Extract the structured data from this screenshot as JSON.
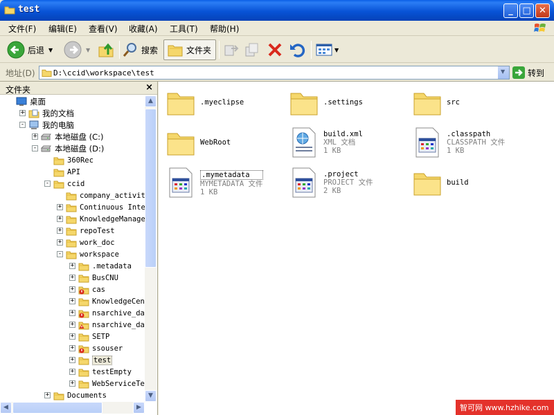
{
  "window": {
    "title": "test",
    "minimize": "_",
    "maximize": "□",
    "close": "✕"
  },
  "menu": [
    "文件(F)",
    "编辑(E)",
    "查看(V)",
    "收藏(A)",
    "工具(T)",
    "帮助(H)"
  ],
  "toolbar": {
    "back": "后退",
    "search": "搜索",
    "folders": "文件夹"
  },
  "address": {
    "label": "地址(D)",
    "value": "D:\\ccid\\workspace\\test",
    "go": "转到"
  },
  "folder_pane": {
    "title": "文件夹",
    "close": "×",
    "tree": [
      {
        "label": "桌面",
        "icon": "desktop-icon",
        "depth": 0,
        "exp": ""
      },
      {
        "label": "我的文档",
        "icon": "my-documents-icon",
        "depth": 1,
        "exp": "+"
      },
      {
        "label": "我的电脑",
        "icon": "my-computer-icon",
        "depth": 1,
        "exp": "-"
      },
      {
        "label": "本地磁盘 (C:)",
        "icon": "drive-icon",
        "depth": 2,
        "exp": "+"
      },
      {
        "label": "本地磁盘 (D:)",
        "icon": "drive-icon",
        "depth": 2,
        "exp": "-"
      },
      {
        "label": "360Rec",
        "icon": "folder-icon",
        "depth": 3,
        "exp": ""
      },
      {
        "label": "API",
        "icon": "folder-icon",
        "depth": 3,
        "exp": ""
      },
      {
        "label": "ccid",
        "icon": "folder-icon",
        "depth": 3,
        "exp": "-"
      },
      {
        "label": "company_activities",
        "icon": "folder-icon",
        "depth": 4,
        "exp": ""
      },
      {
        "label": "Continuous Integration",
        "icon": "folder-icon",
        "depth": 4,
        "exp": "+"
      },
      {
        "label": "KnowledgeManageSystem",
        "icon": "folder-icon",
        "depth": 4,
        "exp": "+"
      },
      {
        "label": "repoTest",
        "icon": "folder-icon",
        "depth": 4,
        "exp": "+"
      },
      {
        "label": "work_doc",
        "icon": "folder-icon",
        "depth": 4,
        "exp": "+"
      },
      {
        "label": "workspace",
        "icon": "folder-icon",
        "depth": 4,
        "exp": "-"
      },
      {
        "label": ".metadata",
        "icon": "folder-icon",
        "depth": 5,
        "exp": "+"
      },
      {
        "label": "BusCNU",
        "icon": "folder-icon",
        "depth": 5,
        "exp": "+"
      },
      {
        "label": "cas",
        "icon": "svn-conflict-folder-icon",
        "depth": 5,
        "exp": "+"
      },
      {
        "label": "KnowledgeCenter",
        "icon": "folder-icon",
        "depth": 5,
        "exp": "+"
      },
      {
        "label": "nsarchive_data",
        "icon": "svn-conflict-folder-icon",
        "depth": 5,
        "exp": "+"
      },
      {
        "label": "nsarchive_data",
        "icon": "svn-modified-folder-icon",
        "depth": 5,
        "exp": "+"
      },
      {
        "label": "SETP",
        "icon": "folder-icon",
        "depth": 5,
        "exp": "+"
      },
      {
        "label": "ssouser",
        "icon": "svn-conflict-folder-icon",
        "depth": 5,
        "exp": "+"
      },
      {
        "label": "test",
        "icon": "folder-icon",
        "depth": 5,
        "exp": "+",
        "selected": true
      },
      {
        "label": "testEmpty",
        "icon": "folder-icon",
        "depth": 5,
        "exp": "+"
      },
      {
        "label": "WebServiceTest",
        "icon": "folder-icon",
        "depth": 5,
        "exp": "+"
      },
      {
        "label": "Documents",
        "icon": "folder-icon",
        "depth": 3,
        "exp": "+"
      }
    ]
  },
  "files": [
    {
      "name": ".myeclipse",
      "type": "",
      "size": "",
      "icon": "folder-icon"
    },
    {
      "name": ".settings",
      "type": "",
      "size": "",
      "icon": "folder-icon"
    },
    {
      "name": "src",
      "type": "",
      "size": "",
      "icon": "folder-icon"
    },
    {
      "name": "WebRoot",
      "type": "",
      "size": "",
      "icon": "folder-icon"
    },
    {
      "name": "build.xml",
      "type": "XML 文档",
      "size": "1 KB",
      "icon": "xml-document-icon"
    },
    {
      "name": ".classpath",
      "type": "CLASSPATH 文件",
      "size": "1 KB",
      "icon": "generic-file-icon"
    },
    {
      "name": ".mymetadata",
      "type": "MYMETADATA 文件",
      "size": "1 KB",
      "icon": "generic-file-icon",
      "focused": true
    },
    {
      "name": ".project",
      "type": "PROJECT 文件",
      "size": "2 KB",
      "icon": "generic-file-icon"
    },
    {
      "name": "build",
      "type": "",
      "size": "",
      "icon": "folder-icon"
    }
  ],
  "watermark": "智可网 www.hzhike.com",
  "colors": {
    "titlebar": "#0853d6",
    "folder": "#f5d76b",
    "chrome": "#ece9d8"
  }
}
